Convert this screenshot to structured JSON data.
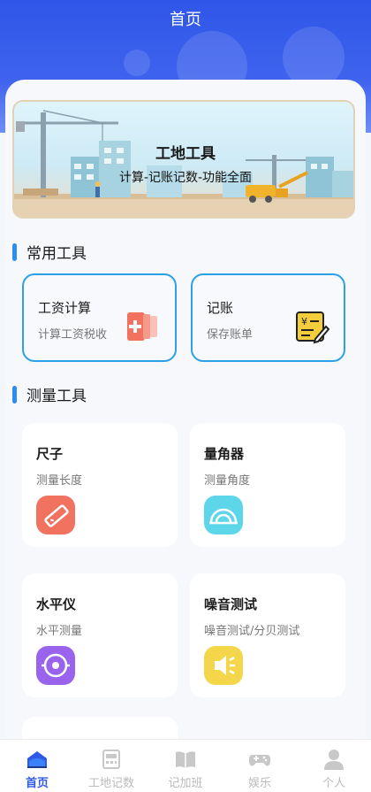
{
  "header": {
    "title": "首页"
  },
  "banner": {
    "title": "工地工具",
    "subtitle": "计算-记账记数-功能全面"
  },
  "sections": {
    "common": "常用工具",
    "measure": "测量工具"
  },
  "common_tools": [
    {
      "title": "工资计算",
      "subtitle": "计算工资税收",
      "icon": "calculator-icon"
    },
    {
      "title": "记账",
      "subtitle": "保存账单",
      "icon": "bill-icon"
    }
  ],
  "measure_tools": [
    {
      "title": "尺子",
      "subtitle": "测量长度",
      "icon": "ruler-icon",
      "color": "#f0725f"
    },
    {
      "title": "量角器",
      "subtitle": "测量角度",
      "icon": "protractor-icon",
      "color": "#5dd6ea"
    },
    {
      "title": "水平仪",
      "subtitle": "水平测量",
      "icon": "level-icon",
      "color": "#9a63ee"
    },
    {
      "title": "噪音测试",
      "subtitle": "噪音测试/分贝测试",
      "icon": "noise-icon",
      "color": "#f3d64a"
    }
  ],
  "tabbar": {
    "items": [
      {
        "label": "首页",
        "icon": "home-icon",
        "active": true
      },
      {
        "label": "工地记数",
        "icon": "counter-icon",
        "active": false
      },
      {
        "label": "记加班",
        "icon": "book-icon",
        "active": false
      },
      {
        "label": "娱乐",
        "icon": "gamepad-icon",
        "active": false
      },
      {
        "label": "个人",
        "icon": "person-icon",
        "active": false
      }
    ]
  },
  "colors": {
    "primary": "#2f56e8",
    "accent": "#2aa1e6"
  }
}
